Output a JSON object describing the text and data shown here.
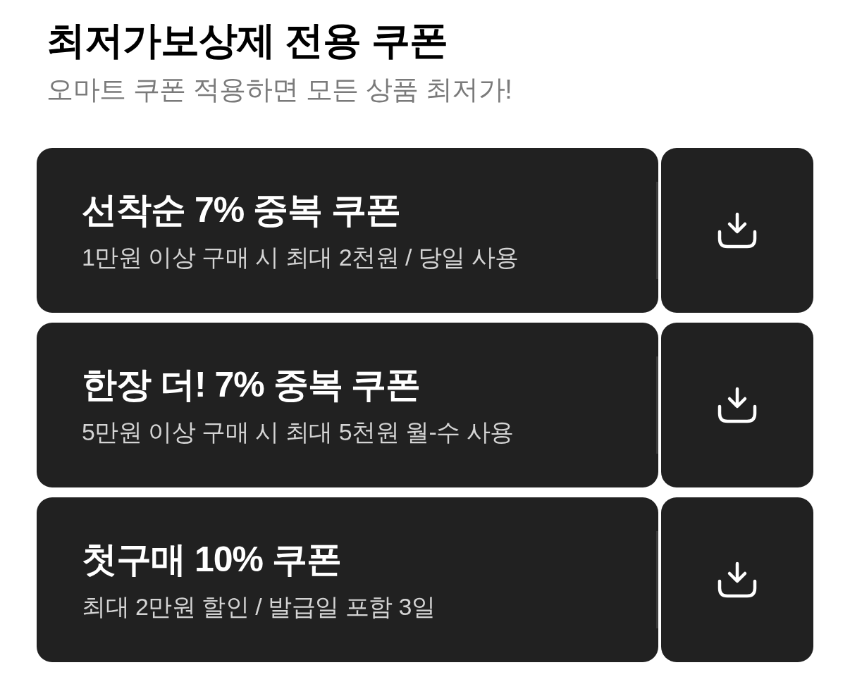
{
  "header": {
    "title": "최저가보상제 전용 쿠폰",
    "subtitle": "오마트 쿠폰 적용하면 모든 상품 최저가!"
  },
  "coupons": [
    {
      "title": "선착순 7% 중복 쿠폰",
      "description": "1만원 이상 구매 시 최대 2천원 / 당일 사용"
    },
    {
      "title": "한장 더! 7% 중복 쿠폰",
      "description": "5만원 이상 구매 시 최대 5천원 월-수 사용"
    },
    {
      "title": "첫구매 10% 쿠폰",
      "description": "최대 2만원 할인 / 발급일 포함 3일"
    }
  ]
}
